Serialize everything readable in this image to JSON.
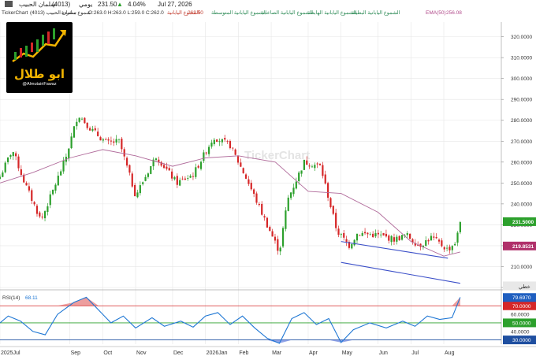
{
  "header": {
    "line1": {
      "name": "سلمان الحبيب",
      "code": "(4013)",
      "interval": "يومي",
      "price": "231.50",
      "arrow": "▲",
      "change": "4.04%",
      "date": "Jul 27, 2026"
    },
    "line2": {
      "source": "TickerChart",
      "symbol": "سلمان الحبيب (4013)",
      "ohlc_label": "شموع منفردة",
      "ohlc": "O:263.0  H:263.0  L:259.0  C:262.0",
      "indicators": [
        {
          "label": "الشموع اليابانية",
          "value": "262.50",
          "color": "#c0392b"
        },
        {
          "label": "الشموع اليابانية المتوسطة",
          "value": "",
          "color": "#2e8b57"
        },
        {
          "label": "الشموع اليابانية الصاعدة",
          "value": "",
          "color": "#2e8b57"
        },
        {
          "label": "الشموع اليابانية الهابطة",
          "value": "",
          "color": "#2e8b57"
        },
        {
          "label": "الشموع اليابانية البطيئة",
          "value": "",
          "color": "#2e8b57"
        },
        {
          "label": "EMA(50)",
          "value": "256.08",
          "color": "#b04a8a"
        }
      ]
    }
  },
  "logo": {
    "name": "ابو طلال",
    "handle": "@AlmutairiFawaz",
    "icon": "bull-candles-icon"
  },
  "watermark": "TickerChart",
  "colors": {
    "up": "#2ca02c",
    "down": "#d62728",
    "ema": "#b06a9a",
    "channel": "#3b4fc8",
    "rsi": "#1f77d4",
    "grid": "#e6e6e6"
  },
  "chart_data": [
    {
      "type": "candlestick",
      "price_axis": {
        "ticks": [
          "320.0000",
          "310.0000",
          "300.0000",
          "290.0000",
          "280.0000",
          "270.0000",
          "260.0000",
          "250.0000",
          "240.0000",
          "230.0000",
          "220.0000",
          "210.0000",
          "200.0000"
        ],
        "range": [
          200,
          324
        ]
      },
      "price_labels": [
        {
          "value": 231.5,
          "text": "231.5000",
          "color": "#2ca02c"
        },
        {
          "value": 219.85,
          "text": "219.8531",
          "color": "#b0306a"
        }
      ],
      "x_axis": {
        "labels": [
          "2025Jul",
          "Sep",
          "Oct",
          "Nov",
          "Dec",
          "2026Jan",
          "Feb",
          "Mar",
          "Apr",
          "May",
          "Jun",
          "Jul",
          "Aug"
        ]
      },
      "series": [
        {
          "name": "EMA(50)",
          "type": "line",
          "points": [
            [
              2025.5,
              250
            ],
            [
              2025.58,
              255
            ],
            [
              2025.67,
              262
            ],
            [
              2025.75,
              266
            ],
            [
              2025.83,
              263
            ],
            [
              2025.92,
              258
            ],
            [
              2026.0,
              262
            ],
            [
              2026.08,
              263
            ],
            [
              2026.17,
              260
            ],
            [
              2026.25,
              246
            ],
            [
              2026.33,
              245
            ],
            [
              2026.42,
              236
            ],
            [
              2026.5,
              222
            ],
            [
              2026.58,
              215
            ],
            [
              2026.62,
              217
            ]
          ]
        },
        {
          "name": "Candles (approx.)",
          "type": "price-path",
          "points": [
            [
              2025.5,
              253
            ],
            [
              2025.53,
              266
            ],
            [
              2025.56,
              250
            ],
            [
              2025.6,
              232
            ],
            [
              2025.66,
              262
            ],
            [
              2025.69,
              283
            ],
            [
              2025.72,
              276
            ],
            [
              2025.76,
              269
            ],
            [
              2025.79,
              270
            ],
            [
              2025.83,
              244
            ],
            [
              2025.88,
              263
            ],
            [
              2025.93,
              250
            ],
            [
              2025.97,
              254
            ],
            [
              2026.02,
              272
            ],
            [
              2026.06,
              268
            ],
            [
              2026.1,
              252
            ],
            [
              2026.15,
              230
            ],
            [
              2026.18,
              217
            ],
            [
              2026.2,
              242
            ],
            [
              2026.24,
              260
            ],
            [
              2026.28,
              258
            ],
            [
              2026.32,
              227
            ],
            [
              2026.35,
              220
            ],
            [
              2026.37,
              226
            ],
            [
              2026.42,
              225
            ],
            [
              2026.46,
              223
            ],
            [
              2026.49,
              225
            ],
            [
              2026.52,
              220
            ],
            [
              2026.55,
              224
            ],
            [
              2026.59,
              218
            ],
            [
              2026.61,
              222
            ],
            [
              2026.62,
              231.5
            ]
          ]
        }
      ],
      "annotations": [
        {
          "type": "channel-line",
          "from": [
            2026.33,
            222
          ],
          "to": [
            2026.59,
            214
          ]
        },
        {
          "type": "channel-line",
          "from": [
            2026.33,
            212
          ],
          "to": [
            2026.62,
            202
          ]
        },
        {
          "type": "horizontal-level",
          "value": 200.6,
          "text": "خطي"
        }
      ]
    },
    {
      "type": "line",
      "title": "RSI(14)",
      "value_label": "RSI(14)",
      "value": "68.11",
      "y_axis": {
        "ticks": [
          "60.0000",
          "40.0000"
        ],
        "range": [
          25,
          85
        ]
      },
      "levels": [
        {
          "value": 70,
          "text": "70.0000",
          "color": "#d62728"
        },
        {
          "value": 50,
          "text": "50.0000",
          "color": "#2ca02c"
        },
        {
          "value": 30,
          "text": "30.0000",
          "color": "#1f4fa0"
        }
      ],
      "current": {
        "value": 79.697,
        "text": "79.6970"
      },
      "series": [
        {
          "name": "RSI(14)",
          "points": [
            [
              2025.5,
              50
            ],
            [
              2025.52,
              58
            ],
            [
              2025.55,
              52
            ],
            [
              2025.58,
              40
            ],
            [
              2025.61,
              36
            ],
            [
              2025.64,
              60
            ],
            [
              2025.68,
              74
            ],
            [
              2025.71,
              80
            ],
            [
              2025.74,
              65
            ],
            [
              2025.77,
              50
            ],
            [
              2025.8,
              58
            ],
            [
              2025.83,
              44
            ],
            [
              2025.87,
              56
            ],
            [
              2025.9,
              46
            ],
            [
              2025.94,
              52
            ],
            [
              2025.97,
              45
            ],
            [
              2026.0,
              58
            ],
            [
              2026.03,
              62
            ],
            [
              2026.06,
              48
            ],
            [
              2026.09,
              58
            ],
            [
              2026.12,
              44
            ],
            [
              2026.15,
              32
            ],
            [
              2026.18,
              26
            ],
            [
              2026.21,
              55
            ],
            [
              2026.24,
              62
            ],
            [
              2026.27,
              48
            ],
            [
              2026.3,
              55
            ],
            [
              2026.33,
              27
            ],
            [
              2026.36,
              42
            ],
            [
              2026.4,
              50
            ],
            [
              2026.44,
              44
            ],
            [
              2026.48,
              52
            ],
            [
              2026.51,
              46
            ],
            [
              2026.54,
              58
            ],
            [
              2026.57,
              54
            ],
            [
              2026.6,
              56
            ],
            [
              2026.62,
              80
            ]
          ]
        }
      ]
    }
  ]
}
